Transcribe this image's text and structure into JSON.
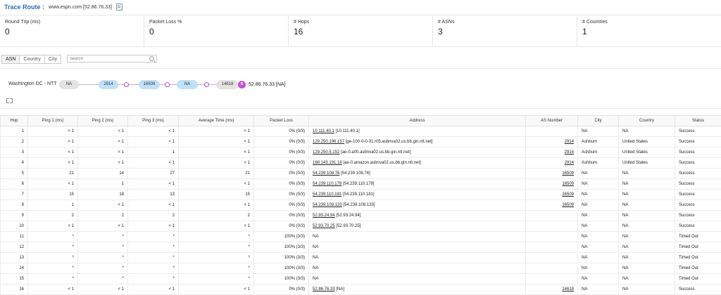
{
  "header": {
    "title": "Trace Route :",
    "target": "www.espn.com [52.86.76.33]"
  },
  "stats": [
    {
      "label": "Round Trip (ms)",
      "value": "0"
    },
    {
      "label": "Packet Loss %",
      "value": "0"
    },
    {
      "label": "# Hops",
      "value": "16"
    },
    {
      "label": "# ASNs",
      "value": "3"
    },
    {
      "label": "# Countries",
      "value": "1"
    }
  ],
  "filters": {
    "tabs": [
      "ASN",
      "Country",
      "City"
    ],
    "active": "ASN",
    "search_placeholder": "Search"
  },
  "path": {
    "source_label": "Washington DC - NTT",
    "nodes": [
      "NA",
      "2914",
      "16509",
      "NA",
      "14618"
    ],
    "end_marker": "0",
    "destination": "52.86.76.33 [NA]"
  },
  "table": {
    "headers": [
      "Hop",
      "Ping 1 (ms)",
      "Ping 2 (ms)",
      "Ping 3 (ms)",
      "Average Time (ms)",
      "Packet Loss",
      "Address",
      "AS Number",
      "City",
      "Country",
      "Status"
    ],
    "rows": [
      {
        "hop": "1",
        "p1": "< 1",
        "p2": "< 1",
        "p3": "< 1",
        "avg": "< 1",
        "loss": "0% (0/3)",
        "addr_link": "10.111.40.1",
        "addr_rest": "[10.111.40.1]",
        "asn": "",
        "city": "NA",
        "country": "NA",
        "status": "Success"
      },
      {
        "hop": "2",
        "p1": "< 1",
        "p2": "< 1",
        "p3": "< 1",
        "avg": "< 1",
        "loss": "0% (0/3)",
        "addr_link": "129.250.196.157",
        "addr_rest": "[ge-100-0-0-31.r05.asbnva02.us.bb.gin.ntt.net]",
        "asn": "2914",
        "city": "Ashburn",
        "country": "United States",
        "status": "Success"
      },
      {
        "hop": "3",
        "p1": "< 1",
        "p2": "< 1",
        "p3": "1",
        "avg": "< 1",
        "loss": "0% (0/3)",
        "addr_link": "129.250.5.152",
        "addr_rest": "[ae-0.a00.asbnva02.us.bb.gin.ntt.net]",
        "asn": "2914",
        "city": "Ashburn",
        "country": "United States",
        "status": "Success"
      },
      {
        "hop": "4",
        "p1": "< 1",
        "p2": "< 1",
        "p3": "< 1",
        "avg": "< 1",
        "loss": "0% (0/3)",
        "addr_link": "168.143.191.18",
        "addr_rest": "[ae-0.amazon.asbnva02.us.bb.gin.ntt.net]",
        "asn": "2914",
        "city": "Ashburn",
        "country": "United States",
        "status": "Success"
      },
      {
        "hop": "5",
        "p1": "21",
        "p2": "14",
        "p3": "27",
        "avg": "21",
        "loss": "0% (0/3)",
        "addr_link": "54.239.108.76",
        "addr_rest": "[54.239.108.76]",
        "asn": "16509",
        "city": "NA",
        "country": "NA",
        "status": "Success"
      },
      {
        "hop": "6",
        "p1": "< 1",
        "p2": "1",
        "p3": "< 1",
        "avg": "< 1",
        "loss": "0% (0/3)",
        "addr_link": "54.239.110.178",
        "addr_rest": "[54.239.110.178]",
        "asn": "16509",
        "city": "NA",
        "country": "NA",
        "status": "Success"
      },
      {
        "hop": "7",
        "p1": "15",
        "p2": "18",
        "p3": "13",
        "avg": "15",
        "loss": "0% (0/3)",
        "addr_link": "54.239.110.181",
        "addr_rest": "[54.239.110.181]",
        "asn": "16509",
        "city": "NA",
        "country": "NA",
        "status": "Success"
      },
      {
        "hop": "8",
        "p1": "1",
        "p2": "< 1",
        "p3": "< 1",
        "avg": "< 1",
        "loss": "0% (0/3)",
        "addr_link": "54.239.108.133",
        "addr_rest": "[54.239.108.133]",
        "asn": "16509",
        "city": "NA",
        "country": "NA",
        "status": "Success"
      },
      {
        "hop": "9",
        "p1": "2",
        "p2": "2",
        "p3": "2",
        "avg": "2",
        "loss": "0% (0/3)",
        "addr_link": "52.93.24.94",
        "addr_rest": "[52.93.24.94]",
        "asn": "",
        "city": "NA",
        "country": "NA",
        "status": "Success"
      },
      {
        "hop": "10",
        "p1": "< 1",
        "p2": "< 1",
        "p3": "< 1",
        "avg": "< 1",
        "loss": "0% (0/3)",
        "addr_link": "52.93.70.25",
        "addr_rest": "[52.93.70.25]",
        "asn": "",
        "city": "NA",
        "country": "NA",
        "status": "Success"
      },
      {
        "hop": "11",
        "p1": "*",
        "p2": "*",
        "p3": "*",
        "avg": "*",
        "loss": "100% (3/3)",
        "addr_link": "",
        "addr_rest": "NA",
        "asn": "",
        "city": "NA",
        "country": "NA",
        "status": "Timed Out"
      },
      {
        "hop": "12",
        "p1": "*",
        "p2": "*",
        "p3": "*",
        "avg": "*",
        "loss": "100% (3/3)",
        "addr_link": "",
        "addr_rest": "NA",
        "asn": "",
        "city": "NA",
        "country": "NA",
        "status": "Timed Out"
      },
      {
        "hop": "13",
        "p1": "*",
        "p2": "*",
        "p3": "*",
        "avg": "*",
        "loss": "100% (3/3)",
        "addr_link": "",
        "addr_rest": "NA",
        "asn": "",
        "city": "NA",
        "country": "NA",
        "status": "Timed Out"
      },
      {
        "hop": "14",
        "p1": "*",
        "p2": "*",
        "p3": "*",
        "avg": "*",
        "loss": "100% (3/3)",
        "addr_link": "",
        "addr_rest": "NA",
        "asn": "",
        "city": "NA",
        "country": "NA",
        "status": "Timed Out"
      },
      {
        "hop": "15",
        "p1": "*",
        "p2": "*",
        "p3": "*",
        "avg": "*",
        "loss": "100% (3/3)",
        "addr_link": "",
        "addr_rest": "NA",
        "asn": "",
        "city": "NA",
        "country": "NA",
        "status": "Timed Out"
      },
      {
        "hop": "16",
        "p1": "< 1",
        "p2": "< 1",
        "p3": "< 1",
        "avg": "< 1",
        "loss": "0% (0/3)",
        "addr_link": "52.86.76.33",
        "addr_rest": "[NA]",
        "asn": "14618",
        "city": "NA",
        "country": "NA",
        "status": "Success"
      }
    ]
  }
}
